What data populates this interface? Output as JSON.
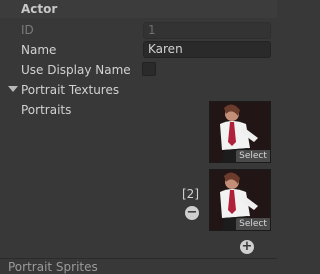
{
  "header": {
    "title": "Actor"
  },
  "fields": {
    "id_label": "ID",
    "id_value": "1",
    "name_label": "Name",
    "name_value": "Karen",
    "use_display_name_label": "Use Display Name",
    "use_display_name_checked": false
  },
  "portrait_textures": {
    "foldout_label": "Portrait Textures",
    "portraits_label": "Portraits",
    "select_label": "Select",
    "second_index_label": "[2]"
  },
  "next_section_label": "Portrait Sprites"
}
